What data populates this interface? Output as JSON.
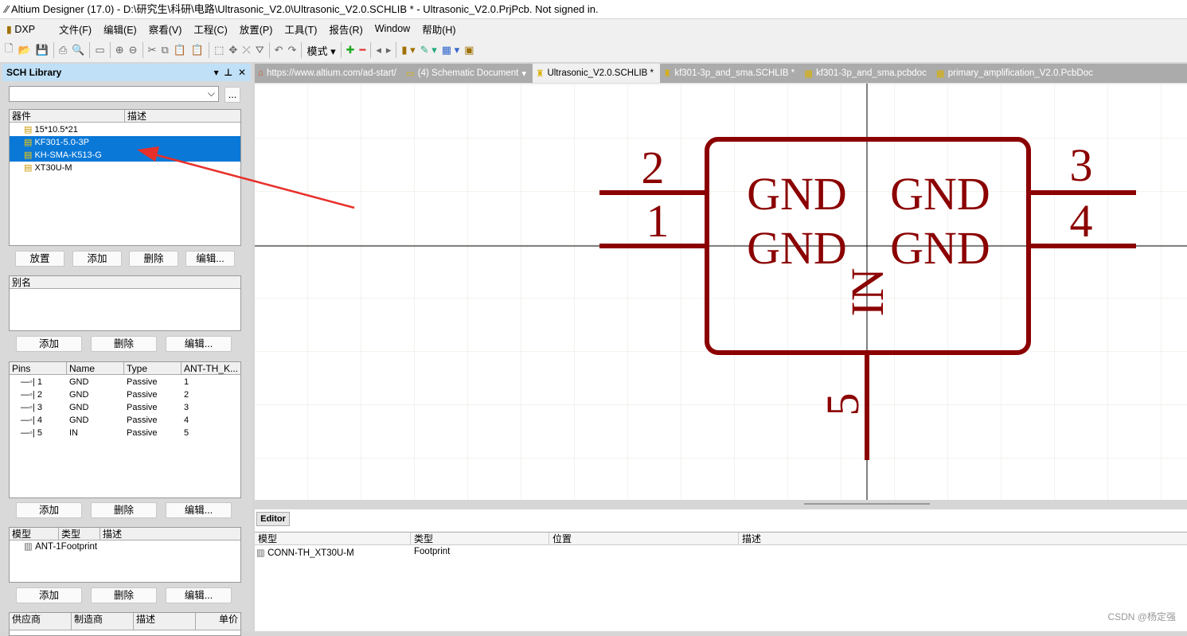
{
  "window": {
    "title": "Altium Designer (17.0) - D:\\研究生\\科研\\电路\\Ultrasonic_V2.0\\Ultrasonic_V2.0.SCHLIB * - Ultrasonic_V2.0.PrjPcb. Not signed in."
  },
  "menu": [
    "DXP",
    "文件(F)",
    "编辑(E)",
    "察看(V)",
    "工程(C)",
    "放置(P)",
    "工具(T)",
    "报告(R)",
    "Window",
    "帮助(H)"
  ],
  "toolbar": {
    "mode_label": "模式"
  },
  "panel": {
    "title": "SCH Library",
    "filter_value": "",
    "filter_button": "...",
    "components": {
      "headers": [
        "器件",
        "描述"
      ],
      "items": [
        {
          "name": "15*10.5*21",
          "selected": false
        },
        {
          "name": "KF301-5.0-3P",
          "selected": true
        },
        {
          "name": "KH-SMA-K513-G",
          "selected": true
        },
        {
          "name": "XT30U-M",
          "selected": false
        }
      ],
      "buttons": [
        "放置",
        "添加",
        "删除",
        "编辑..."
      ]
    },
    "aliases": {
      "headers": [
        "别名"
      ],
      "buttons": [
        "添加",
        "删除",
        "编辑..."
      ]
    },
    "pins": {
      "headers": [
        "Pins",
        "Name",
        "Type",
        "ANT-TH_K..."
      ],
      "rows": [
        [
          "1",
          "GND",
          "Passive",
          "1"
        ],
        [
          "2",
          "GND",
          "Passive",
          "2"
        ],
        [
          "3",
          "GND",
          "Passive",
          "3"
        ],
        [
          "4",
          "GND",
          "Passive",
          "4"
        ],
        [
          "5",
          "IN",
          "Passive",
          "5"
        ]
      ],
      "buttons": [
        "添加",
        "删除",
        "编辑..."
      ]
    },
    "models": {
      "headers": [
        "模型",
        "类型",
        "描述"
      ],
      "items": [
        "ANT-1Footprint"
      ],
      "buttons": [
        "添加",
        "删除",
        "编辑..."
      ]
    },
    "suppliers": {
      "headers": [
        "供应商",
        "制造商",
        "描述",
        "单价"
      ]
    }
  },
  "tabs": [
    {
      "label": "https://www.altium.com/ad-start/",
      "active": false
    },
    {
      "label": "(4) Schematic Document",
      "active": false
    },
    {
      "label": "Ultrasonic_V2.0.SCHLIB *",
      "active": true
    },
    {
      "label": "kf301-3p_and_sma.SCHLIB *",
      "active": false
    },
    {
      "label": "kf301-3p_and_sma.pcbdoc",
      "active": false
    },
    {
      "label": "primary_amplification_V2.0.PcbDoc",
      "active": false
    }
  ],
  "schematic": {
    "color": "#8b0000",
    "pin_numbers": [
      "2",
      "1",
      "3",
      "4",
      "5"
    ],
    "pin_names": [
      "GND",
      "GND",
      "GND",
      "GND",
      "IN"
    ]
  },
  "editor": {
    "tab": "Editor",
    "headers": [
      "模型",
      "类型",
      "位置",
      "描述"
    ],
    "rows": [
      [
        "CONN-TH_XT30U-M",
        "Footprint",
        "",
        ""
      ]
    ]
  },
  "watermark": "CSDN @杨定强"
}
